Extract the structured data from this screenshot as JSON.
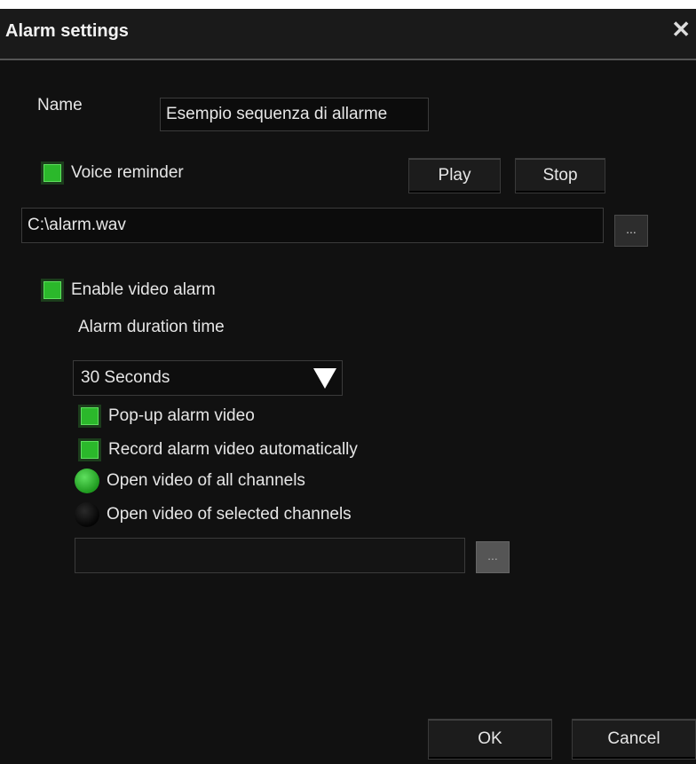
{
  "dialog": {
    "title": "Alarm settings",
    "close_glyph": "✕"
  },
  "name": {
    "label": "Name",
    "value": "Esempio sequenza di allarme"
  },
  "voice": {
    "label": "Voice reminder",
    "checked": true,
    "play_label": "Play",
    "stop_label": "Stop",
    "file_path": "C:\\alarm.wav",
    "browse_label": "..."
  },
  "video": {
    "enable_label": "Enable video alarm",
    "enable_checked": true,
    "duration_label": "Alarm duration time",
    "duration_value": "30 Seconds",
    "popup_label": "Pop-up alarm video",
    "popup_checked": true,
    "record_label": "Record alarm video automatically",
    "record_checked": true,
    "open_all_label": "Open video of all channels",
    "open_selected_label": "Open video of selected channels",
    "selected_mode": "all",
    "channels_value": "",
    "channels_browse_label": "..."
  },
  "footer": {
    "ok_label": "OK",
    "cancel_label": "Cancel"
  },
  "colors": {
    "background": "#111111",
    "check_green": "#2bb82b",
    "text": "#e6e6e6"
  }
}
